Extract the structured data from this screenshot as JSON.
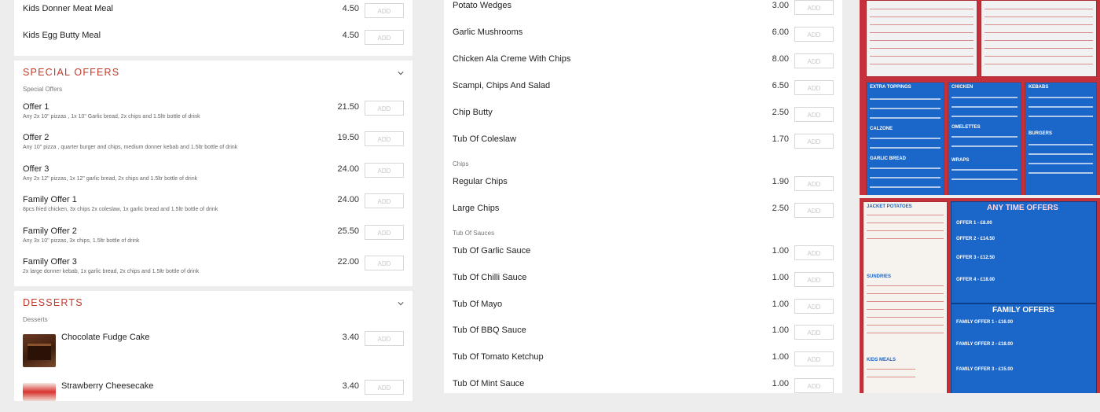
{
  "add_label": "ADD",
  "left": {
    "top_items": [
      {
        "name": "Kids Donner Meat Meal",
        "price": "4.50"
      },
      {
        "name": "Kids Egg Butty Meal",
        "price": "4.50"
      }
    ],
    "special_offers": {
      "title": "SPECIAL OFFERS",
      "subtitle": "Special Offers",
      "items": [
        {
          "name": "Offer 1",
          "desc": "Any 2x 10\" pizzas , 1x 10\" Garlic bread, 2x chips and 1.5ltr bottle of drink",
          "price": "21.50"
        },
        {
          "name": "Offer 2",
          "desc": "Any 10\" pizza , quarter burger and chips, medium donner kebab and 1.5ltr bottle of drink",
          "price": "19.50"
        },
        {
          "name": "Offer 3",
          "desc": "Any 2x 12\" pizzas, 1x 12\" garlic bread, 2x chips and 1.5ltr bottle of drink",
          "price": "24.00"
        },
        {
          "name": "Family Offer 1",
          "desc": "8pcs fried chicken, 3x chips 2x coleslaw, 1x garlic bread and 1.5ltr bottle of drink",
          "price": "24.00"
        },
        {
          "name": "Family Offer 2",
          "desc": "Any 3x 10\" pizzas, 3x chips, 1.5ltr bottle of drink",
          "price": "25.50"
        },
        {
          "name": "Family Offer 3",
          "desc": "2x large donner kebab, 1x garlic bread, 2x chips and 1.5ltr bottle of drink",
          "price": "22.00"
        }
      ]
    },
    "desserts": {
      "title": "DESSERTS",
      "subtitle": "Desserts",
      "items": [
        {
          "name": "Chocolate Fudge Cake",
          "price": "3.40"
        },
        {
          "name": "Strawberry Cheesecake",
          "price": "3.40"
        }
      ]
    }
  },
  "middle": {
    "items_a": [
      {
        "name": "Potato Wedges",
        "price": "3.00"
      },
      {
        "name": "Garlic Mushrooms",
        "price": "6.00"
      },
      {
        "name": "Chicken Ala Creme With Chips",
        "price": "8.00"
      },
      {
        "name": "Scampi, Chips And Salad",
        "price": "6.50"
      },
      {
        "name": "Chip Butty",
        "price": "2.50"
      },
      {
        "name": "Tub Of Coleslaw",
        "price": "1.70"
      }
    ],
    "chips_label": "Chips",
    "chips": [
      {
        "name": "Regular Chips",
        "price": "1.90"
      },
      {
        "name": "Large Chips",
        "price": "2.50"
      }
    ],
    "sauces_label": "Tub Of Sauces",
    "sauces": [
      {
        "name": "Tub Of Garlic Sauce",
        "price": "1.00"
      },
      {
        "name": "Tub Of Chilli Sauce",
        "price": "1.00"
      },
      {
        "name": "Tub Of Mayo",
        "price": "1.00"
      },
      {
        "name": "Tub Of BBQ Sauce",
        "price": "1.00"
      },
      {
        "name": "Tub Of Tomato Ketchup",
        "price": "1.00"
      },
      {
        "name": "Tub Of Mint Sauce",
        "price": "1.00"
      }
    ]
  },
  "menu_photo": {
    "headings": [
      "EXTRA TOPPINGS",
      "CHICKEN",
      "KEBABS",
      "CALZONE",
      "OMELETTES",
      "BURGERS",
      "GARLIC BREAD",
      "WRAPS",
      "JACKET POTATOES",
      "ANY TIME OFFERS",
      "SUNDRIES",
      "FAMILY OFFERS",
      "KIDS MEALS"
    ],
    "offers": [
      "OFFER 1 - £8.00",
      "OFFER 2 - £14.50",
      "OFFER 3 - £12.50",
      "OFFER 4 - £18.00",
      "FAMILY OFFER 1 - £16.00",
      "FAMILY OFFER 2 - £18.00",
      "FAMILY OFFER 3 - £15.00"
    ]
  },
  "colors": {
    "accent": "#c0392b",
    "menu_red": "#c4313a",
    "menu_blue": "#1b66c9"
  }
}
